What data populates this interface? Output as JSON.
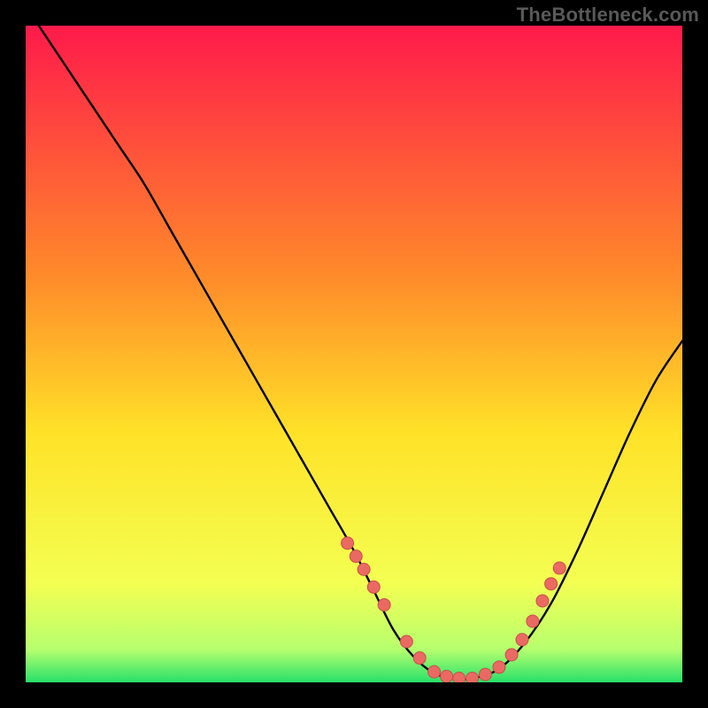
{
  "watermark": "TheBottleneck.com",
  "colors": {
    "grad_top": "#ff1a4b",
    "grad_mid_upper": "#ff8a2a",
    "grad_mid": "#ffe228",
    "grad_lower": "#f3ff52",
    "grad_near_bottom": "#b6ff6e",
    "grad_bottom": "#27e06a",
    "curve": "#000000",
    "dot_fill": "#ea6a63",
    "dot_stroke": "#c94f49"
  },
  "chart_data": {
    "type": "line",
    "title": "",
    "xlabel": "",
    "ylabel": "",
    "xlim": [
      0,
      100
    ],
    "ylim": [
      0,
      100
    ],
    "series": [
      {
        "name": "bottleneck-curve",
        "x": [
          2,
          6,
          10,
          14,
          18,
          22,
          26,
          30,
          34,
          38,
          42,
          46,
          50,
          53,
          56,
          59,
          62,
          65,
          68,
          72,
          76,
          80,
          84,
          88,
          92,
          96,
          100
        ],
        "y": [
          100,
          94,
          88,
          82,
          76,
          69,
          62,
          55,
          48,
          41,
          34,
          27,
          20,
          14,
          8,
          4,
          1.5,
          0.6,
          0.6,
          2,
          6,
          12,
          20,
          29,
          38,
          46,
          52
        ]
      }
    ],
    "dots_series": {
      "name": "highlight-dots",
      "x": [
        49.0,
        50.3,
        51.5,
        53.0,
        54.6,
        58.0,
        60.0,
        62.2,
        64.1,
        66.0,
        68.0,
        70.0,
        72.1,
        74.0,
        75.6,
        77.2,
        78.7,
        80.0,
        81.3
      ],
      "y": [
        21.2,
        19.2,
        17.2,
        14.5,
        11.8,
        6.2,
        3.7,
        1.6,
        0.9,
        0.6,
        0.6,
        1.2,
        2.3,
        4.2,
        6.5,
        9.3,
        12.4,
        15.0,
        17.4
      ]
    }
  }
}
